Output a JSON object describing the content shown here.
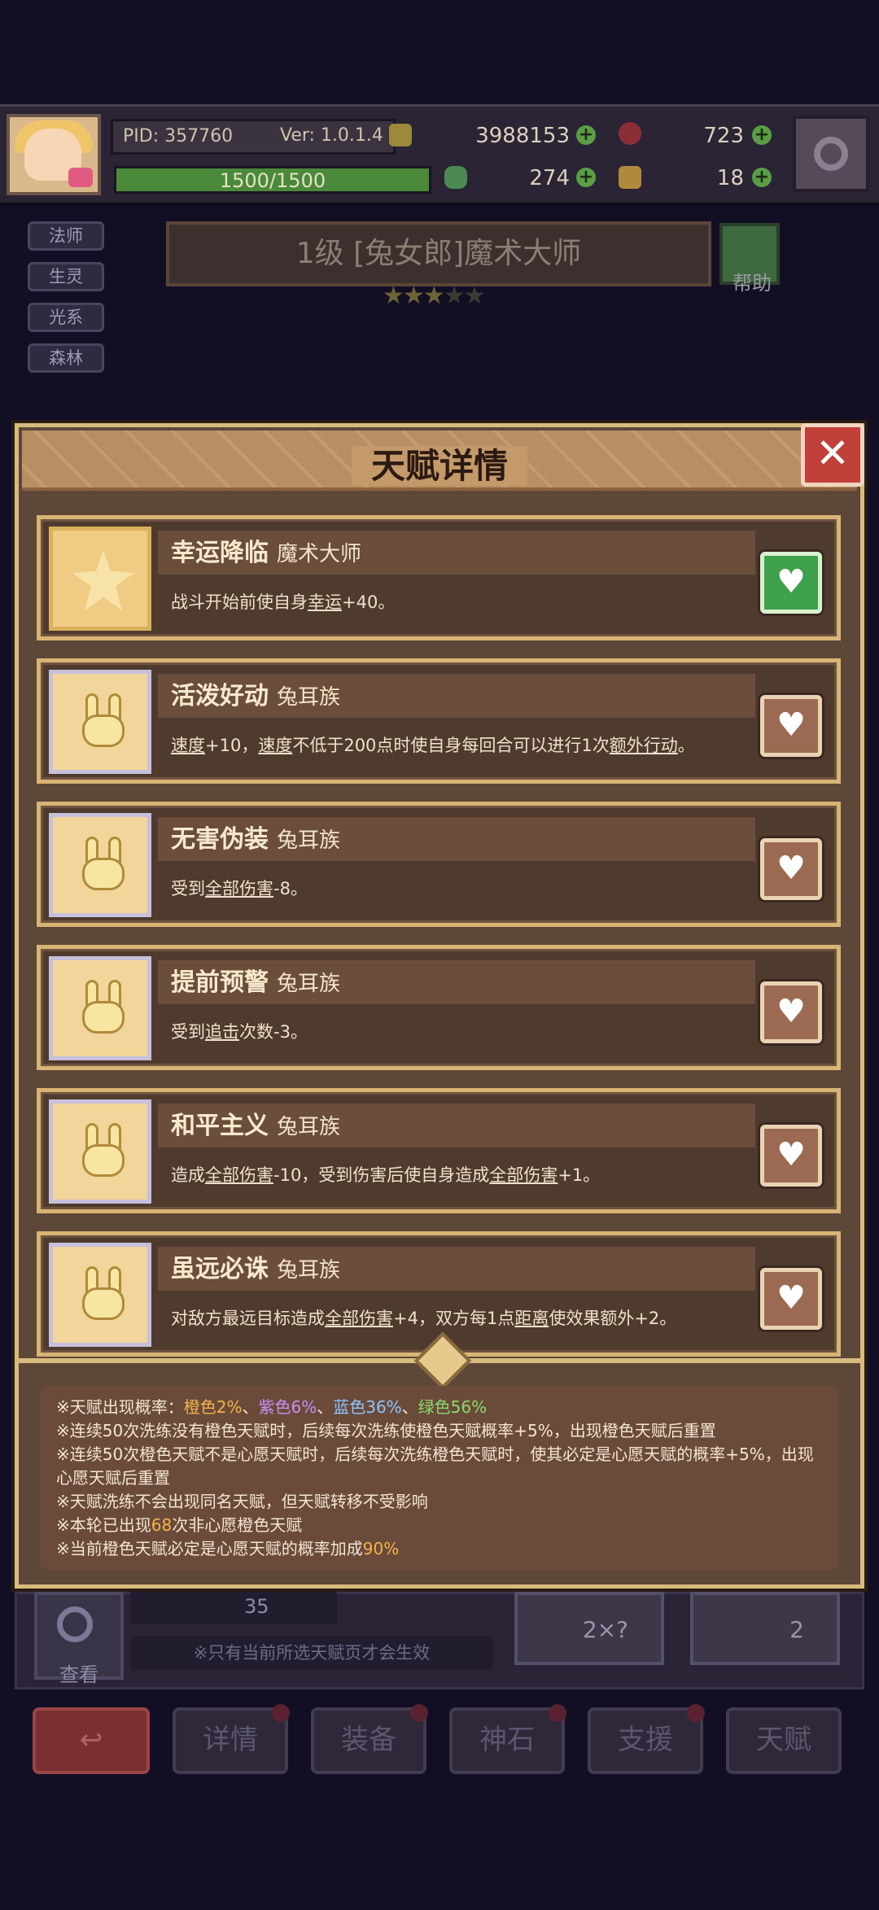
{
  "header": {
    "pid": "PID: 357760",
    "version": "Ver: 1.0.1.4",
    "gold": "3988153",
    "gems": "723",
    "hp": "1500/1500",
    "hp_fraction": 1.0,
    "clover": "274",
    "keys": "18"
  },
  "hero_tags": [
    "法师",
    "生灵",
    "光系",
    "森林"
  ],
  "hero": {
    "banner": "1级 [兔女郎]魔术大师",
    "help_label": "帮助",
    "stars_filled": 3,
    "stars_total": 5
  },
  "modal": {
    "title": "天赋详情",
    "close_icon": "✕",
    "talents": [
      {
        "name": "幸运降临",
        "race": "魔术大师",
        "icon": "star-icon",
        "active": true,
        "desc": [
          {
            "t": "战斗开始前使自身"
          },
          {
            "t": "幸运",
            "u": true
          },
          {
            "t": "+40。"
          }
        ]
      },
      {
        "name": "活泼好动",
        "race": "兔耳族",
        "icon": "bunny-icon",
        "active": false,
        "desc": [
          {
            "t": "速度",
            "u": true
          },
          {
            "t": "+10，"
          },
          {
            "t": "速度",
            "u": true
          },
          {
            "t": "不低于200点时使自身每回合可以进行1次"
          },
          {
            "t": "额外行动",
            "u": true
          },
          {
            "t": "。"
          }
        ]
      },
      {
        "name": "无害伪装",
        "race": "兔耳族",
        "icon": "bunny-icon",
        "active": false,
        "desc": [
          {
            "t": "受到"
          },
          {
            "t": "全部伤害",
            "u": true
          },
          {
            "t": "-8。"
          }
        ]
      },
      {
        "name": "提前预警",
        "race": "兔耳族",
        "icon": "bunny-icon",
        "active": false,
        "desc": [
          {
            "t": "受到"
          },
          {
            "t": "追击",
            "u": true
          },
          {
            "t": "次数-3。"
          }
        ]
      },
      {
        "name": "和平主义",
        "race": "兔耳族",
        "icon": "bunny-icon",
        "active": false,
        "desc": [
          {
            "t": "造成"
          },
          {
            "t": "全部伤害",
            "u": true
          },
          {
            "t": "-10，受到伤害后使自身造成"
          },
          {
            "t": "全部伤害",
            "u": true
          },
          {
            "t": "+1。"
          }
        ]
      },
      {
        "name": "虽远必诛",
        "race": "兔耳族",
        "icon": "bunny-icon",
        "active": false,
        "desc": [
          {
            "t": "对敌方最远目标造成"
          },
          {
            "t": "全部伤害",
            "u": true
          },
          {
            "t": "+4，双方每1点"
          },
          {
            "t": "距离",
            "u": true
          },
          {
            "t": "使效果额外+2。"
          }
        ]
      }
    ],
    "notes": [
      [
        {
          "t": "※天赋出现概率："
        },
        {
          "t": "橙色2%",
          "c": "o"
        },
        {
          "t": "、"
        },
        {
          "t": "紫色6%",
          "c": "p"
        },
        {
          "t": "、"
        },
        {
          "t": "蓝色36%",
          "c": "b"
        },
        {
          "t": "、"
        },
        {
          "t": "绿色56%",
          "c": "g"
        }
      ],
      [
        {
          "t": "※连续50次洗练没有橙色天赋时，后续每次洗练使橙色天赋概率+5%，出现橙色天赋后重置"
        }
      ],
      [
        {
          "t": "※连续50次橙色天赋不是心愿天赋时，后续每次洗练橙色天赋时，使其必定是心愿天赋的概率+5%，出现心愿天赋后重置"
        }
      ],
      [
        {
          "t": "※天赋洗练不会出现同名天赋，但天赋转移不受影响"
        }
      ],
      [
        {
          "t": "※本轮已出现"
        },
        {
          "t": "68",
          "c": "o"
        },
        {
          "t": "次非心愿橙色天赋"
        }
      ],
      [
        {
          "t": "※当前橙色天赋必定是心愿天赋的概率加成"
        },
        {
          "t": "90%",
          "c": "o"
        }
      ]
    ]
  },
  "lower": {
    "search_label": "查看",
    "count": "35",
    "hint": "※只有当前所选天赋页才会生效",
    "auto_wash_count": "2×?",
    "wash_count": "2"
  },
  "nav": {
    "back_icon": "↩",
    "items": [
      "详情",
      "装备",
      "神石",
      "支援",
      "天赋"
    ]
  },
  "colors": {
    "orange": "#f4b24c",
    "purple": "#c68ff4",
    "blue": "#8ec5ff",
    "green": "#8bd96a",
    "card_border": "#d8b574",
    "heart_active": "#3fa14c"
  }
}
